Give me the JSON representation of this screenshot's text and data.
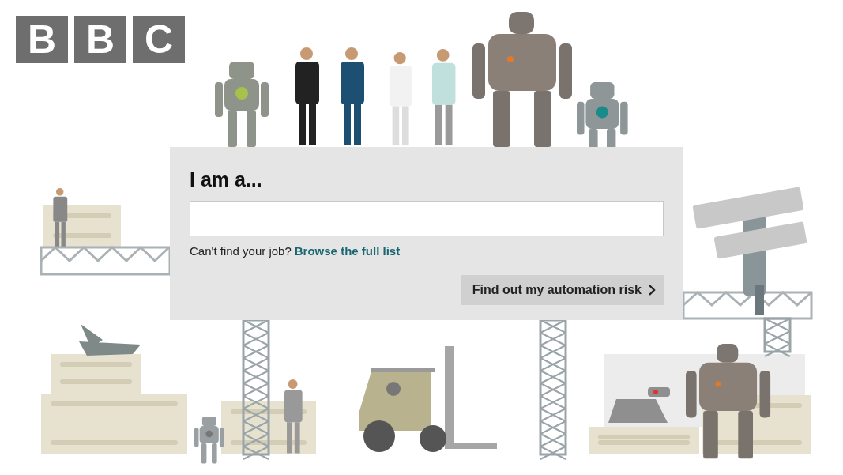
{
  "logo": {
    "letters": [
      "B",
      "B",
      "C"
    ]
  },
  "job_search": {
    "heading": "I am a...",
    "help_text": "Can't find your job?",
    "help_link": "Browse the full list",
    "submit_button": "Find out my automation risk"
  }
}
